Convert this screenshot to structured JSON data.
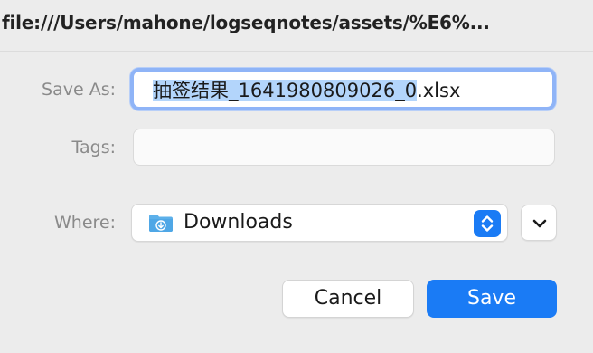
{
  "window": {
    "title": "file:///Users/mahone/logseqnotes/assets/%E6%..."
  },
  "save_as": {
    "label": "Save As:",
    "value_selected": "抽签结果_1641980809026_0",
    "value_extension": ".xlsx"
  },
  "tags": {
    "label": "Tags:",
    "value": ""
  },
  "where": {
    "label": "Where:",
    "selected": "Downloads",
    "folder_icon": "downloads-folder-icon",
    "stepper_icon": "up-down-chevrons-icon"
  },
  "expand": {
    "icon": "chevron-down-icon"
  },
  "buttons": {
    "cancel_label": "Cancel",
    "save_label": "Save"
  },
  "colors": {
    "accent": "#1a7bf5",
    "focus_ring": "#8fb4f7",
    "selection": "#b3d5fb",
    "folder": "#4fa7e6"
  }
}
